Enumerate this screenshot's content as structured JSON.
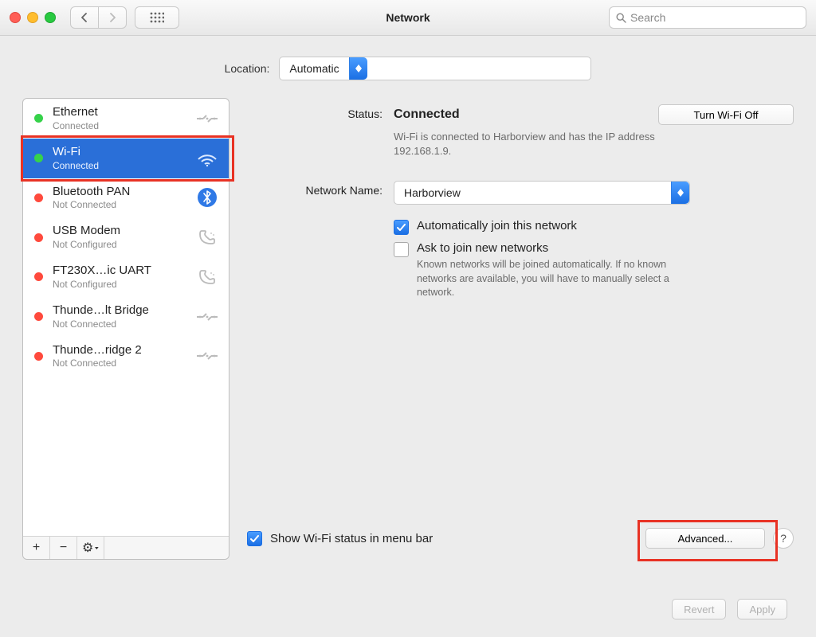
{
  "titlebar": {
    "title": "Network",
    "search_placeholder": "Search"
  },
  "location": {
    "label": "Location:",
    "value": "Automatic"
  },
  "sidebar": {
    "items": [
      {
        "name": "Ethernet",
        "sub": "Connected",
        "bullet": "green",
        "icon": "ethernet"
      },
      {
        "name": "Wi-Fi",
        "sub": "Connected",
        "bullet": "green",
        "icon": "wifi",
        "selected": true
      },
      {
        "name": "Bluetooth PAN",
        "sub": "Not Connected",
        "bullet": "red",
        "icon": "bluetooth"
      },
      {
        "name": "USB Modem",
        "sub": "Not Configured",
        "bullet": "red",
        "icon": "phone"
      },
      {
        "name": "FT230X…ic UART",
        "sub": "Not Configured",
        "bullet": "red",
        "icon": "phone"
      },
      {
        "name": "Thunde…lt Bridge",
        "sub": "Not Connected",
        "bullet": "red",
        "icon": "ethernet"
      },
      {
        "name": "Thunde…ridge 2",
        "sub": "Not Connected",
        "bullet": "red",
        "icon": "ethernet"
      }
    ],
    "footer": {
      "add": "+",
      "remove": "−",
      "gear": "⚙"
    }
  },
  "detail": {
    "status_label": "Status:",
    "status_value": "Connected",
    "wifi_toggle": "Turn Wi-Fi Off",
    "status_desc": "Wi-Fi is connected to Harborview and has the IP address 192.168.1.9.",
    "network_label": "Network Name:",
    "network_value": "Harborview",
    "auto_join": "Automatically join this network",
    "ask_join": "Ask to join new networks",
    "ask_join_desc": "Known networks will be joined automatically. If no known networks are available, you will have to manually select a network.",
    "show_in_menubar": "Show Wi-Fi status in menu bar",
    "advanced": "Advanced...",
    "help": "?"
  },
  "bottom": {
    "revert": "Revert",
    "apply": "Apply"
  }
}
